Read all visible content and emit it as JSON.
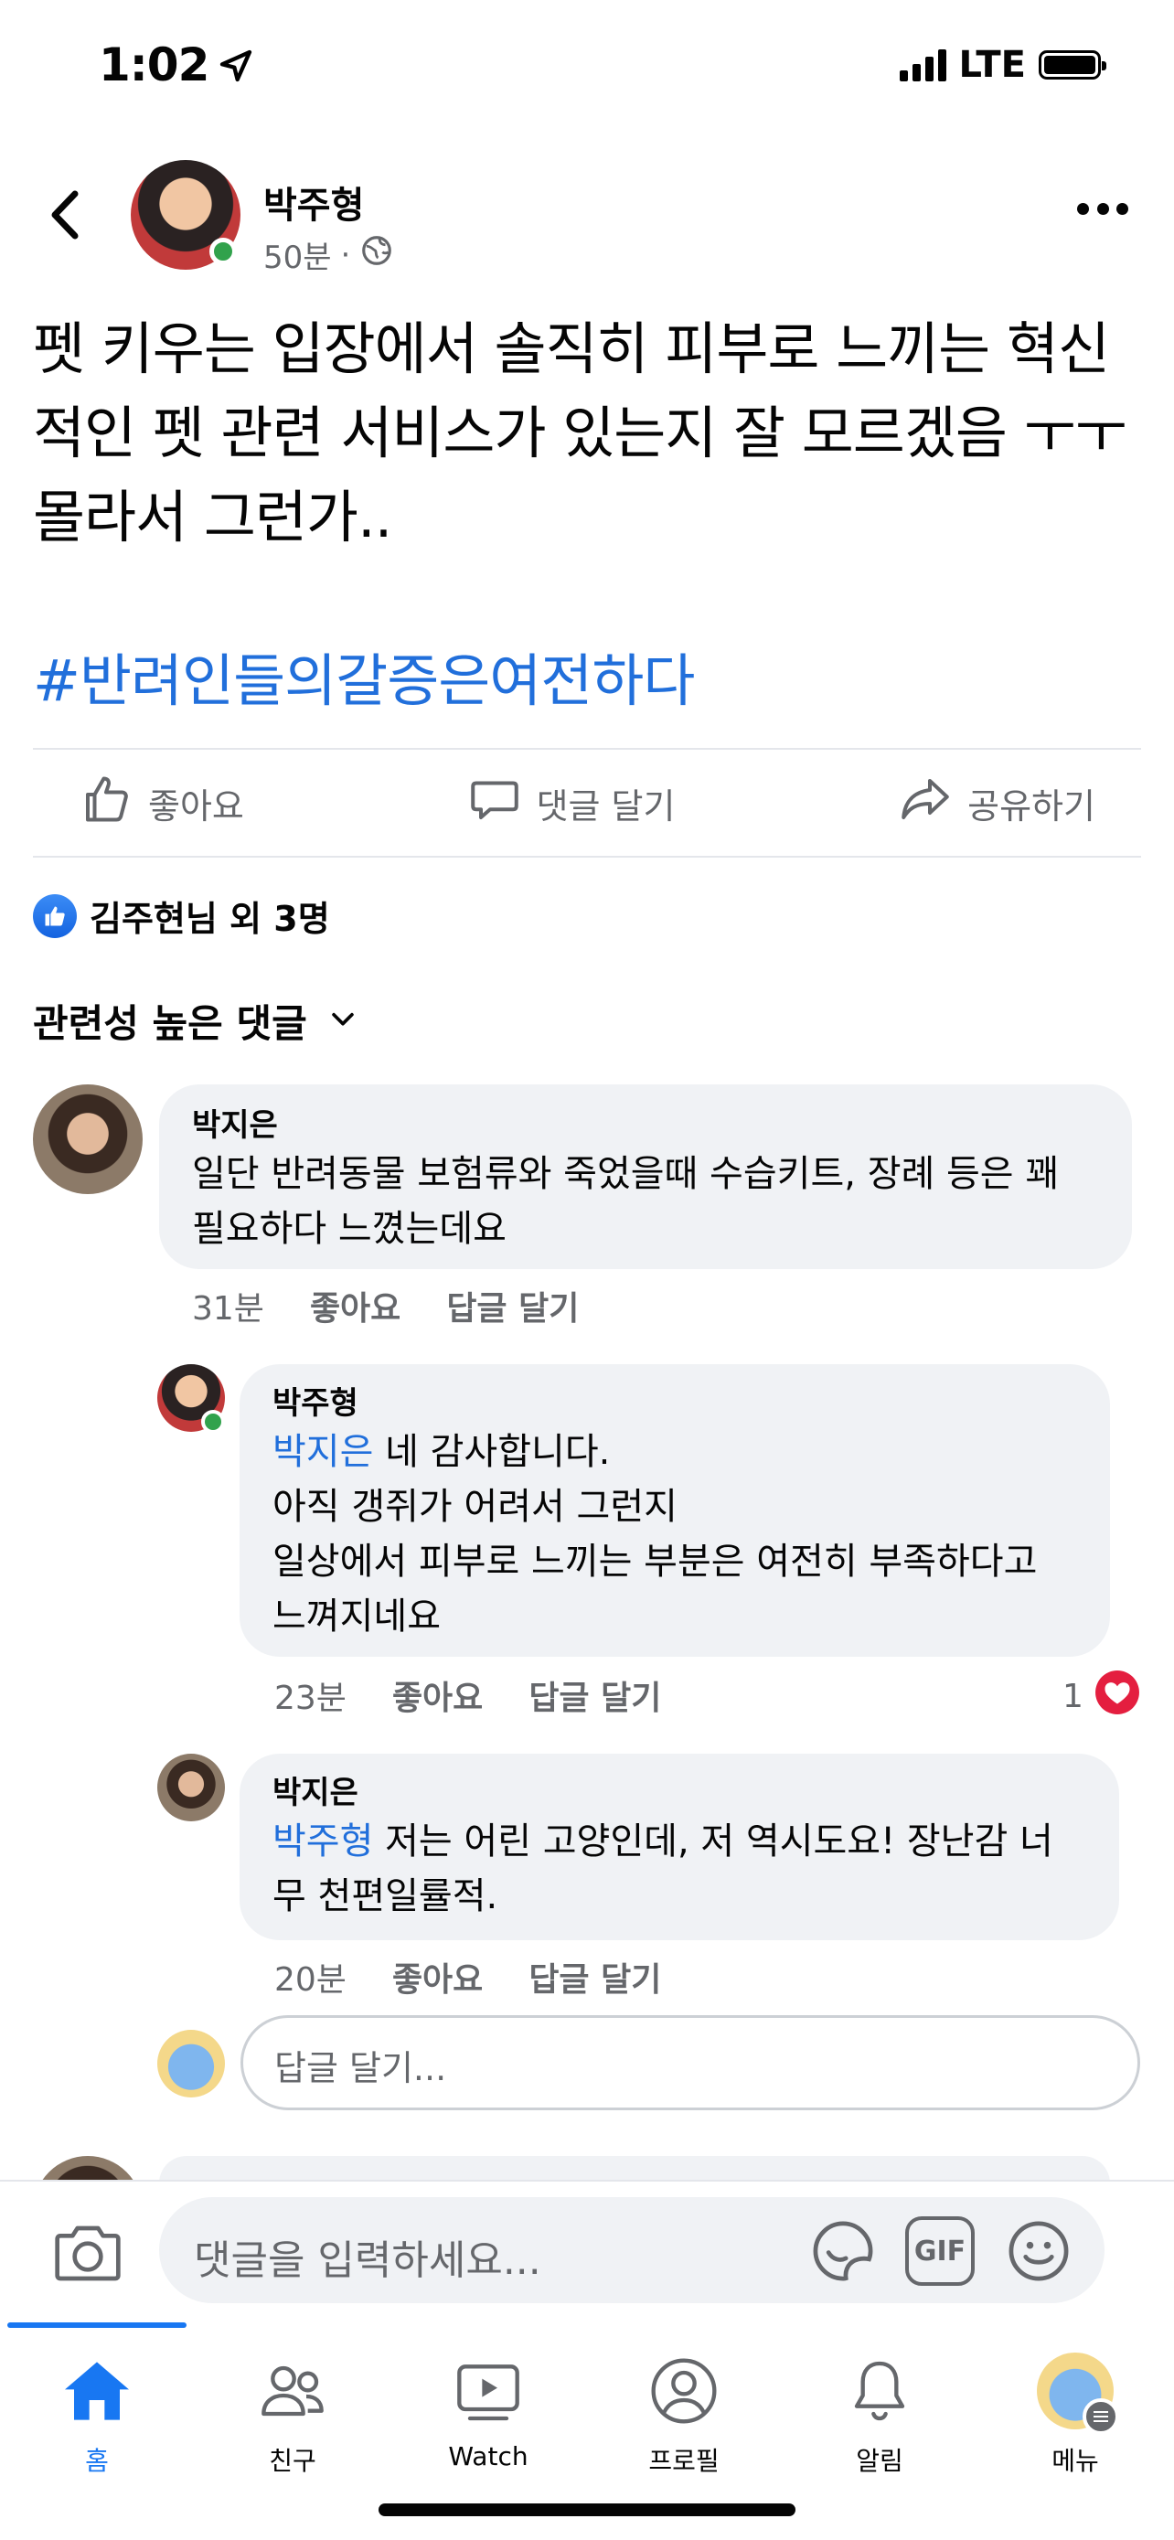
{
  "status_bar": {
    "time": "1:02",
    "network": "LTE"
  },
  "post": {
    "author": "박주형",
    "time": "50분",
    "separator": "·",
    "text": "펫 키우는 입장에서 솔직히 피부로 느끼는 혁신적인 펫 관련 서비스가 있는지 잘 모르겠음 ㅜㅜ 몰라서 그런가..",
    "hashtag": "#반려인들의갈증은여전하다",
    "actions": {
      "like": "좋아요",
      "comment": "댓글 달기",
      "share": "공유하기"
    },
    "likes_summary": "김주현님 외 3명"
  },
  "comments_sort": "관련성 높은 댓글",
  "comments": [
    {
      "name": "박지은",
      "text": "일단 반려동물 보험류와 죽었을때 수습키트, 장례 등은 꽤 필요하다 느꼈는데요",
      "time": "31분",
      "like_label": "좋아요",
      "reply_label": "답글 달기"
    }
  ],
  "replies": [
    {
      "name": "박주형",
      "mention": "박지은",
      "text": " 네 감사합니다.",
      "line2": "아직 갱쥐가 어려서 그런지",
      "line3": "일상에서 피부로 느끼는 부분은 여전히 부족하다고",
      "line4": "느껴지네요",
      "time": "23분",
      "like_label": "좋아요",
      "reply_label": "답글 달기",
      "reaction_count": "1"
    },
    {
      "name": "박지은",
      "mention": "박주형",
      "text": " 저는 어린 고양인데, 저 역시도요! 장난감 너",
      "line2": "무 천편일률적.",
      "time": "20분",
      "like_label": "좋아요",
      "reply_label": "답글 달기"
    }
  ],
  "reply_input_placeholder": "답글 달기...",
  "composer": {
    "placeholder": "댓글을 입력하세요...",
    "gif_label": "GIF"
  },
  "tabs": [
    {
      "label": "홈",
      "icon": "home-icon",
      "active": true
    },
    {
      "label": "친구",
      "icon": "friends-icon"
    },
    {
      "label": "Watch",
      "icon": "watch-icon"
    },
    {
      "label": "프로필",
      "icon": "profile-icon"
    },
    {
      "label": "알림",
      "icon": "bell-icon"
    },
    {
      "label": "메뉴",
      "icon": "menu-avatar-icon"
    }
  ],
  "colors": {
    "accent": "#1877f2",
    "mention": "#216fdb",
    "online": "#31a24c",
    "heart": "#e41e3f"
  }
}
